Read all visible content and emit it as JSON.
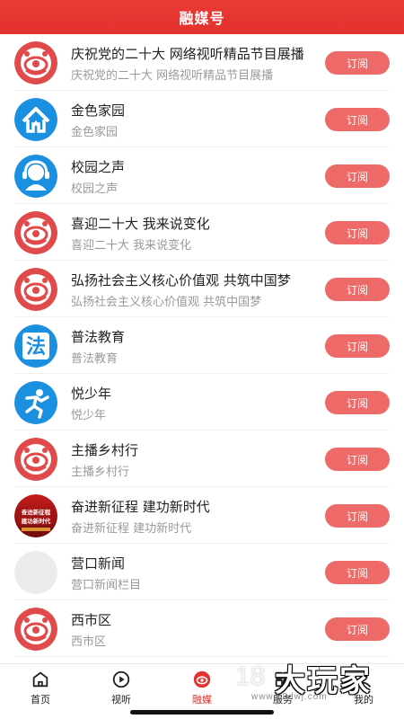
{
  "header": {
    "title": "融媒号"
  },
  "items": [
    {
      "title": "庆祝党的二十大 网络视听精品节目展播",
      "subtitle": "庆祝党的二十大 网络视听精品节目展播",
      "button": "订阅",
      "icon": "red-logo-icon"
    },
    {
      "title": "金色家园",
      "subtitle": "金色家园",
      "button": "订阅",
      "icon": "house-icon"
    },
    {
      "title": "校园之声",
      "subtitle": "校园之声",
      "button": "订阅",
      "icon": "headset-person-icon"
    },
    {
      "title": "喜迎二十大 我来说变化",
      "subtitle": "喜迎二十大 我来说变化",
      "button": "订阅",
      "icon": "red-logo-icon"
    },
    {
      "title": "弘扬社会主义核心价值观 共筑中国梦",
      "subtitle": "弘扬社会主义核心价值观 共筑中国梦",
      "button": "订阅",
      "icon": "red-logo-icon"
    },
    {
      "title": "普法教育",
      "subtitle": "普法教育",
      "button": "订阅",
      "icon": "law-icon"
    },
    {
      "title": "悦少年",
      "subtitle": "悦少年",
      "button": "订阅",
      "icon": "running-kid-icon"
    },
    {
      "title": "主播乡村行",
      "subtitle": "主播乡村行",
      "button": "订阅",
      "icon": "red-logo-icon"
    },
    {
      "title": "奋进新征程 建功新时代",
      "subtitle": "奋进新征程 建功新时代",
      "button": "订阅",
      "icon": "banner-image-icon",
      "banner_text": [
        "奋进新征程",
        "建功新时代"
      ]
    },
    {
      "title": "营口新闻",
      "subtitle": "营口新闻栏目",
      "button": "订阅",
      "icon": "placeholder-avatar-icon"
    },
    {
      "title": "西市区",
      "subtitle": "西市区",
      "button": "订阅",
      "icon": "red-logo-icon"
    }
  ],
  "tabs": [
    {
      "label": "首页",
      "icon": "home-icon",
      "active": false
    },
    {
      "label": "视听",
      "icon": "play-icon",
      "active": false
    },
    {
      "label": "融媒",
      "icon": "media-icon",
      "active": true
    },
    {
      "label": "服务",
      "icon": "service-icon",
      "active": false
    },
    {
      "label": "我的",
      "icon": "profile-icon",
      "active": false
    }
  ],
  "watermark": {
    "num": "18",
    "text": "大玩家",
    "url": "www.18dwj.com"
  },
  "colors": {
    "accent": "#e4322f",
    "button": "#ee6a68",
    "blue": "#1b8fe0"
  }
}
